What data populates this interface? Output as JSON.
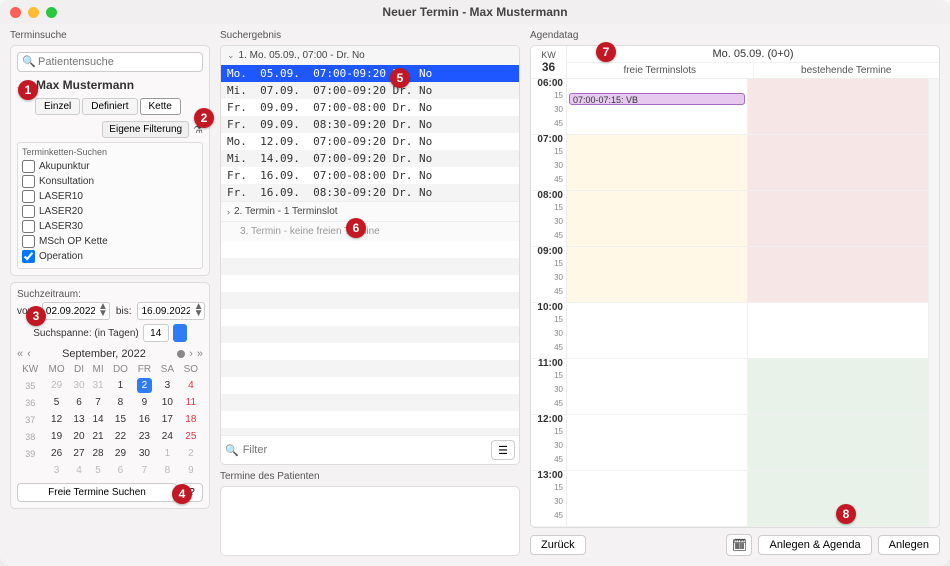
{
  "window_title": "Neuer Termin - Max Mustermann",
  "left": {
    "section": "Terminsuche",
    "search_placeholder": "Patientensuche",
    "patient": "Max Mustermann",
    "tabs": {
      "einzel": "Einzel",
      "definiert": "Definiert",
      "kette": "Kette"
    },
    "own_filter": "Eigene Filterung",
    "chain_header": "Terminketten-Suchen",
    "chains": [
      {
        "label": "Akupunktur",
        "checked": false
      },
      {
        "label": "Konsultation",
        "checked": false
      },
      {
        "label": "LASER10",
        "checked": false
      },
      {
        "label": "LASER20",
        "checked": false
      },
      {
        "label": "LASER30",
        "checked": false
      },
      {
        "label": "MSch OP Kette",
        "checked": false
      },
      {
        "label": "Operation",
        "checked": true
      }
    ],
    "period": {
      "label": "Suchzeitraum:",
      "von_lbl": "von:",
      "von": "02.09.2022",
      "bis_lbl": "bis:",
      "bis": "16.09.2022",
      "span_lbl": "Suchspanne: (in Tagen)",
      "span": "14"
    },
    "cal": {
      "month": "September, 2022",
      "dow": [
        "KW",
        "MO",
        "DI",
        "MI",
        "DO",
        "FR",
        "SA",
        "SO"
      ],
      "rows": [
        {
          "kw": "35",
          "d": [
            "29",
            "30",
            "31",
            "1",
            "2",
            "3",
            "4"
          ],
          "dim": [
            0,
            1,
            2
          ]
        },
        {
          "kw": "36",
          "d": [
            "5",
            "6",
            "7",
            "8",
            "9",
            "10",
            "11"
          ]
        },
        {
          "kw": "37",
          "d": [
            "12",
            "13",
            "14",
            "15",
            "16",
            "17",
            "18"
          ]
        },
        {
          "kw": "38",
          "d": [
            "19",
            "20",
            "21",
            "22",
            "23",
            "24",
            "25"
          ]
        },
        {
          "kw": "39",
          "d": [
            "26",
            "27",
            "28",
            "29",
            "30",
            "1",
            "2"
          ],
          "dim": [
            5,
            6
          ]
        },
        {
          "kw": "",
          "d": [
            "3",
            "4",
            "5",
            "6",
            "7",
            "8",
            "9"
          ],
          "dim": [
            0,
            1,
            2,
            3,
            4,
            5,
            6
          ]
        }
      ],
      "today": [
        0,
        4
      ],
      "search_btn": "Freie Termine Suchen",
      "help": "?"
    }
  },
  "mid": {
    "section": "Suchergebnis",
    "heading1": "1. Mo. 05.09., 07:00 - Dr. No",
    "slots": [
      "Mo.  05.09.  07:00-09:20 Dr. No",
      "Mi.  07.09.  07:00-09:20 Dr. No",
      "Fr.  09.09.  07:00-08:00 Dr. No",
      "Fr.  09.09.  08:30-09:20 Dr. No",
      "Mo.  12.09.  07:00-09:20 Dr. No",
      "Mi.  14.09.  07:00-09:20 Dr. No",
      "Fr.  16.09.  07:00-08:00 Dr. No",
      "Fr.  16.09.  08:30-09:20 Dr. No"
    ],
    "heading2": "2. Termin - 1 Terminslot",
    "heading3": "3. Termin - keine freien Termine",
    "filter_placeholder": "Filter",
    "pt_terms_title": "Termine des Patienten"
  },
  "right": {
    "section": "Agendatag",
    "kw_lbl": "KW",
    "kw": "36",
    "day": "Mo. 05.09. (0+0)",
    "col_free": "freie Terminslots",
    "col_exist": "bestehende Termine",
    "hours": [
      "06",
      "07",
      "08",
      "09",
      "10",
      "11",
      "12",
      "13"
    ],
    "appt": "07:00-07:15: VB",
    "back": "Zurück",
    "create_agenda": "Anlegen & Agenda",
    "create": "Anlegen"
  },
  "badges": [
    "1",
    "2",
    "3",
    "4",
    "5",
    "6",
    "7",
    "8"
  ]
}
